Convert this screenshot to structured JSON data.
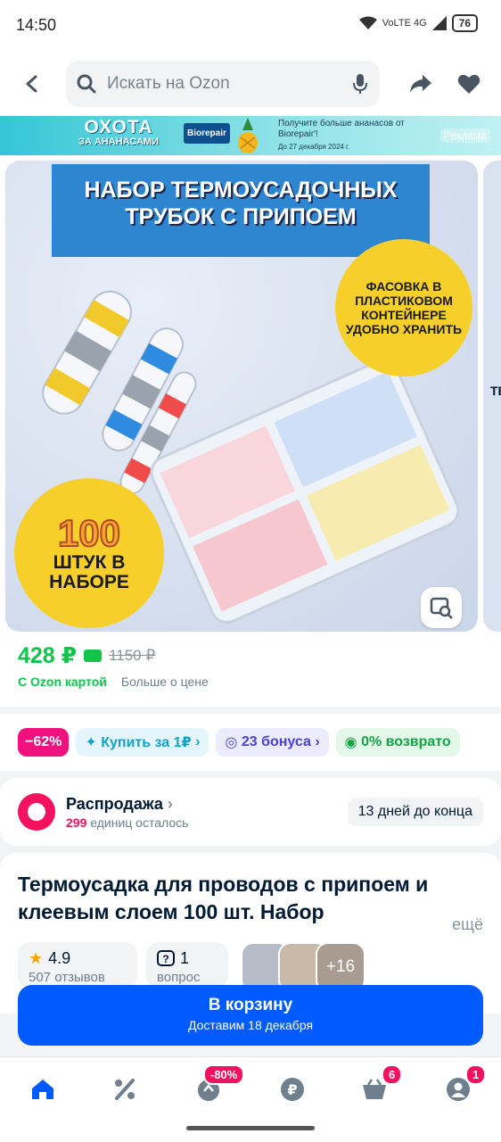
{
  "status_bar": {
    "time": "14:50",
    "network": "VoLTE 4G",
    "battery": "76"
  },
  "search": {
    "placeholder": "Искать на Ozon"
  },
  "ad_banner": {
    "title_top": "ОХОТА",
    "title_bottom": "ЗА АНАНАСАМИ",
    "brand": "Biorepair",
    "text": "Получите больше ананасов от Biorepair'!",
    "date": "До 27 декабря 2024 г.",
    "label": "Реклама"
  },
  "product_image": {
    "headline": "НАБОР ТЕРМОУСАДОЧНЫХ ТРУБОК С ПРИПОЕМ",
    "badge_top": "ФАСОВКА В ПЛАСТИКОВОМ КОНТЕЙНЕРЕ УДОБНО ХРАНИТЬ",
    "badge_number": "100",
    "badge_text": "ШТУК В НАБОРЕ",
    "next_photo_text": "ТЕ"
  },
  "price": {
    "current": "428 ₽",
    "old": "1150 ₽",
    "ozon_card": "С Ozon картой",
    "more": "Больше о цене"
  },
  "chips": {
    "discount": "−62%",
    "buy": "Купить за 1₽",
    "bonus": "23 бонуса",
    "return": "0% возврато"
  },
  "sale": {
    "title": "Распродажа",
    "count": "299",
    "count_text": "единиц осталось",
    "days": "13 дней до конца"
  },
  "product": {
    "title": "Термоусадка для проводов с припоем и клеевым слоем 100 шт. Набор",
    "more": "ещё",
    "rating": "4.9",
    "reviews": "507 отзывов",
    "questions": "1",
    "questions_label": "вопрос",
    "more_photos": "+16"
  },
  "cta": {
    "label": "В корзину",
    "delivery": "Доставим 18 декабря"
  },
  "tabbar": {
    "discount_badge": "-80%",
    "cart_badge": "6",
    "profile_badge": "1"
  },
  "colors": {
    "brand": "#005bff",
    "price": "#10c44c",
    "sale": "#f4125e"
  }
}
